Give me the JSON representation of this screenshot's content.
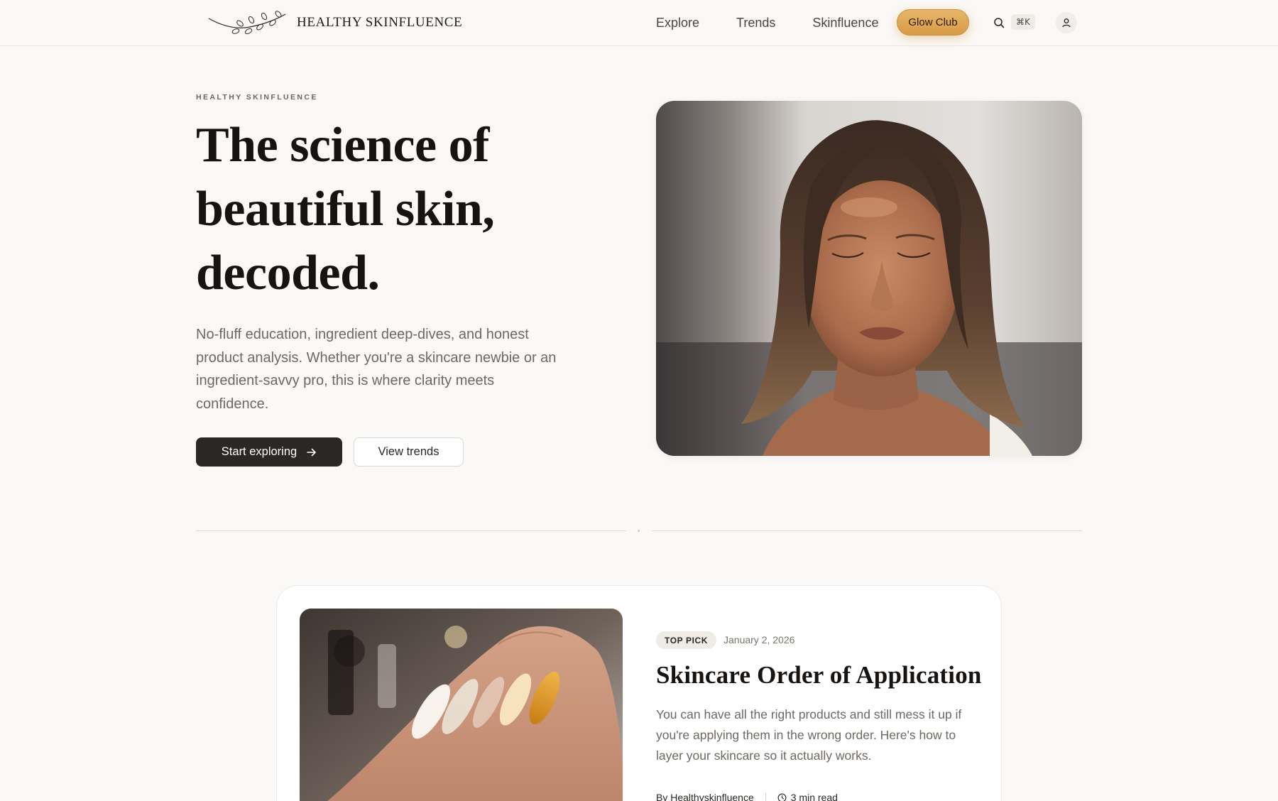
{
  "brand": {
    "name": "HEALTHY SKINFLUENCE"
  },
  "nav": {
    "links": [
      "Explore",
      "Trends",
      "Skinfluence"
    ],
    "cta": "Glow Club",
    "search_shortcut": "⌘K"
  },
  "hero": {
    "eyebrow": "HEALTHY SKINFLUENCE",
    "title": "The science of beautiful skin, decoded.",
    "body": "No-fluff education, ingredient deep-dives, and honest product analysis. Whether you're a skincare newbie or an ingredient-savvy pro, this is where clarity meets confidence.",
    "primary_button": "Start exploring",
    "secondary_button": "View trends"
  },
  "featured": {
    "badge": "TOP PICK",
    "date": "January 2, 2026",
    "title": "Skincare Order of Application",
    "excerpt": "You can have all the right products and still mess it up if you're applying them in the wrong order. Here's how to layer your skincare so it actually works.",
    "author": "By Healthyskinfluence",
    "read_time": "3 min read"
  },
  "colors": {
    "background": "#faf9f7",
    "primary_button": "#2a2724",
    "accent_gold": "#dca454"
  },
  "icons": [
    "branch-logo-icon",
    "search-icon",
    "user-icon",
    "arrow-right-icon",
    "clock-icon"
  ]
}
